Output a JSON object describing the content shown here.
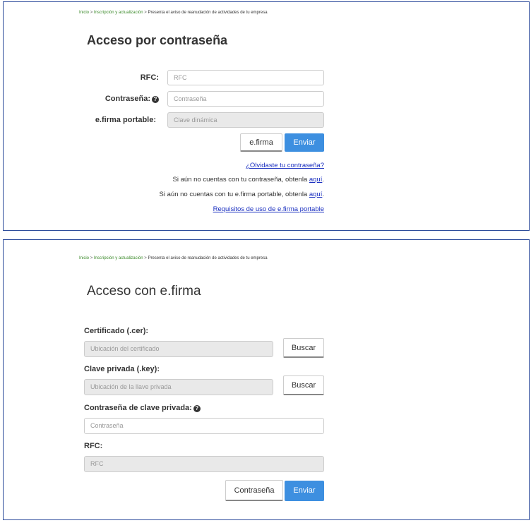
{
  "breadcrumb": {
    "home": "Inicio",
    "section": "Inscripción y actualización",
    "separator": ">",
    "current": "Presenta el aviso de reanudación de actividades de tu empresa"
  },
  "password_login": {
    "title": "Acceso por contraseña",
    "rfc_label": "RFC:",
    "rfc_placeholder": "RFC",
    "password_label": "Contraseña:",
    "password_placeholder": "Contraseña",
    "efirma_portable_label": "e.firma portable:",
    "efirma_portable_placeholder": "Clave dinámica",
    "efirma_button": "e.firma",
    "submit_button": "Enviar",
    "forgot_password": "¿Olvidaste tu contraseña?",
    "no_password_text": "Si aún no cuentas con tu contraseña, obtenla",
    "no_password_link": "aquí",
    "no_efirma_text": "Si aún no cuentas con tu e.firma portable, obtenla",
    "no_efirma_link": "aquí",
    "period": ".",
    "requirements_link": "Requisitos de uso de e.firma portable"
  },
  "efirma_login": {
    "title": "Acceso con e.firma",
    "certificate_label": "Certificado (.cer):",
    "certificate_placeholder": "Ubicación del certificado",
    "browse_button_1": "Buscar",
    "private_key_label": "Clave privada (.key):",
    "private_key_placeholder": "Ubicación de la llave privada",
    "browse_button_2": "Buscar",
    "key_password_label": "Contraseña de clave privada:",
    "key_password_placeholder": "Contraseña",
    "rfc_label": "RFC:",
    "rfc_placeholder": "RFC",
    "password_button": "Contraseña",
    "submit_button": "Enviar"
  },
  "icons": {
    "help": "question-circle-icon"
  },
  "colors": {
    "accent_blue": "#3d8fe0",
    "link_blue": "#1a2fc0",
    "breadcrumb_green": "#3b8a2a",
    "panel_border": "#2b4a9a"
  }
}
